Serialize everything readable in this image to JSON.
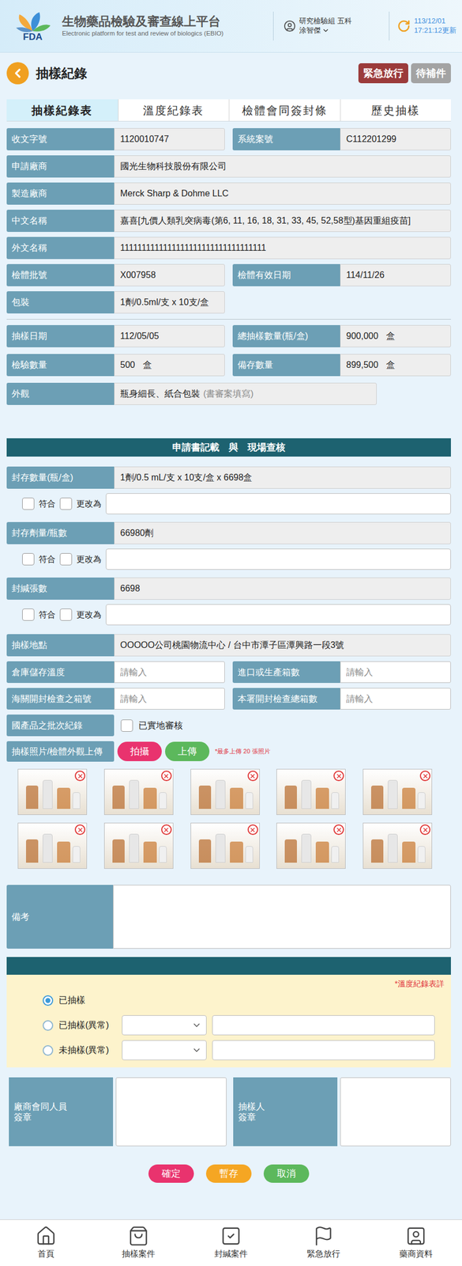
{
  "header": {
    "logo": "FDA",
    "title": "生物藥品檢驗及審查線上平台",
    "subtitle": "Electronic platform for test and review of biologics (EBIO)",
    "user_dept": "研究檢驗組 五科",
    "user_name": "涂智傑",
    "date": "113/12/01",
    "updated": "17:21:12更新"
  },
  "page": {
    "title": "抽樣紀錄",
    "actions": [
      {
        "label": "緊急放行",
        "kind": "danger"
      },
      {
        "label": "待補件",
        "kind": "muted"
      }
    ]
  },
  "tabs": [
    {
      "label": "抽樣紀錄表",
      "selected": true
    },
    {
      "label": "溫度紀錄表",
      "selected": false
    },
    {
      "label": "檢體會同簽封條",
      "selected": false
    },
    {
      "label": "歷史抽樣",
      "selected": false
    }
  ],
  "info_top": [
    {
      "kind": "pair",
      "fields": [
        {
          "label": "收文字號",
          "value": "1120010747"
        },
        {
          "label": "系統案號",
          "value": "C112201299"
        }
      ]
    },
    {
      "kind": "full",
      "fields": [
        {
          "label": "申請廠商",
          "value": "國光生物科技股份有限公司"
        }
      ]
    },
    {
      "kind": "full",
      "fields": [
        {
          "label": "製造廠商",
          "value": "Merck Sharp & Dohme LLC"
        }
      ]
    },
    {
      "kind": "full",
      "fields": [
        {
          "label": "中文名稱",
          "value": "嘉喜[九價人類乳突病毒(第6, 11, 16, 18, 31, 33, 45, 52,58型)基因重組疫苗]"
        }
      ]
    },
    {
      "kind": "full",
      "fields": [
        {
          "label": "外文名稱",
          "value": "1111111111111111111111111111111111"
        }
      ]
    },
    {
      "kind": "pair",
      "fields": [
        {
          "label": "檢體批號",
          "value": "X007958"
        },
        {
          "label": "檢體有效日期",
          "value": "114/11/26"
        }
      ]
    },
    {
      "kind": "half",
      "fields": [
        {
          "label": "包裝",
          "value": "1劑/0.5ml/支 x 10支/盒"
        }
      ]
    }
  ],
  "info_bottom": [
    {
      "kind": "pair",
      "fields": [
        {
          "label": "抽樣日期",
          "value": "112/05/05"
        },
        {
          "label": "總抽樣數量(瓶/盒)",
          "value": "900,000",
          "unit": "盒"
        }
      ]
    },
    {
      "kind": "pair",
      "fields": [
        {
          "label": "檢驗數量",
          "value": "500",
          "unit": "盒"
        },
        {
          "label": "備存數量",
          "value": "899,500",
          "unit": "盒"
        }
      ]
    },
    {
      "kind": "wide",
      "fields": [
        {
          "label": "外觀",
          "value": "瓶身細長、紙合包裝",
          "hint": "(書審案填寫)"
        }
      ]
    }
  ],
  "section_title": "申請書記載　與　現場查核",
  "check_rows": [
    {
      "label": "封存數量(瓶/盒)",
      "value": "1劑/0.5 mL/支 x 10支/盒 x 6698盒",
      "options": [
        {
          "label": "符合",
          "checked": false
        },
        {
          "label": "更改為",
          "checked": false
        }
      ],
      "input": ""
    },
    {
      "label": "封存劑量/瓶數",
      "value": "66980劑",
      "options": [
        {
          "label": "符合",
          "checked": false
        },
        {
          "label": "更改為",
          "checked": false
        }
      ],
      "input": ""
    },
    {
      "label": "封緘張數",
      "value": "6698",
      "options": [
        {
          "label": "符合",
          "checked": false
        },
        {
          "label": "更改為",
          "checked": false
        }
      ],
      "input": ""
    }
  ],
  "location": {
    "label": "抽樣地點",
    "value": "OOOOO公司桃園物流中心 / 台中市潭子區潭興路一段3號"
  },
  "input_rows": [
    [
      {
        "label": "倉庫儲存溫度",
        "placeholder": "請輸入",
        "value": ""
      },
      {
        "label": "進口或生產箱數",
        "placeholder": "請輸入",
        "value": ""
      }
    ],
    [
      {
        "label": "海關開封檢查之箱號",
        "placeholder": "請輸入",
        "value": ""
      },
      {
        "label": "本署開封檢查總箱數",
        "placeholder": "請輸入",
        "value": ""
      }
    ]
  ],
  "batch_record": {
    "label": "國產品之批次紀錄",
    "option": {
      "label": "已實地審核",
      "checked": false
    }
  },
  "photos": {
    "label": "抽樣照片/檢體外觀上傳",
    "buttons": [
      {
        "label": "拍攝",
        "kind": "camera"
      },
      {
        "label": "上傳",
        "kind": "upload"
      }
    ],
    "note": "*最多上傳 20 張照片",
    "items": [
      {
        "removable": true
      },
      {
        "removable": true
      },
      {
        "removable": true
      },
      {
        "removable": true
      },
      {
        "removable": true
      },
      {
        "removable": true
      },
      {
        "removable": true
      },
      {
        "removable": true
      },
      {
        "removable": true
      },
      {
        "removable": true
      }
    ]
  },
  "remarks": {
    "label": "備考",
    "value": ""
  },
  "status": {
    "note": "*溫度紀錄表詳",
    "options": [
      {
        "label": "已抽樣",
        "selected": true,
        "kind": "plain"
      },
      {
        "label": "已抽樣(異常)",
        "selected": false,
        "kind": "detail",
        "reason": "",
        "detail": ""
      },
      {
        "label": "未抽樣(異常)",
        "selected": false,
        "kind": "detail",
        "reason": "",
        "detail": ""
      }
    ]
  },
  "signatures": [
    {
      "lines": [
        "廠商會同人員",
        "簽章"
      ]
    },
    {
      "lines": [
        "抽樣人",
        "簽章"
      ]
    }
  ],
  "buttons": [
    {
      "label": "確定",
      "kind": "confirm"
    },
    {
      "label": "暫存",
      "kind": "save"
    },
    {
      "label": "取消",
      "kind": "cancel"
    }
  ],
  "nav": [
    {
      "label": "首頁"
    },
    {
      "label": "抽樣案件"
    },
    {
      "label": "封緘案件"
    },
    {
      "label": "緊急放行"
    },
    {
      "label": "藥商資料"
    }
  ]
}
